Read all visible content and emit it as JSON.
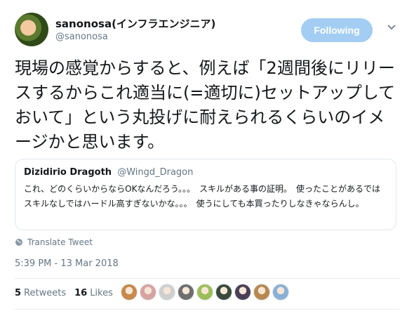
{
  "header": {
    "name": "sanonosa(インフラエンジニア)",
    "handle": "@sanonosa",
    "follow_label": "Following"
  },
  "tweet": {
    "text": "現場の感覚からすると、例えば「2週間後にリリースするからこれ適当に(=適切に)セットアップしておいて」という丸投げに耐えられるくらいのイメージかと思います。"
  },
  "quote": {
    "name": "Dizidirio Dragoth",
    "handle": "@Wingd_Dragon",
    "text": "これ、どのくらいからならOKなんだろう。。。　スキルがある事の証明。　使ったことがあるではスキルなしではハードル高すぎないかな。。。　使うにしても本買ったりしなきゃならんし。"
  },
  "translate_label": "Translate Tweet",
  "timestamp": "5:39 PM - 13 Mar 2018",
  "stats": {
    "retweets_count": "5",
    "retweets_label": "Retweets",
    "likes_count": "16",
    "likes_label": "Likes"
  },
  "likers": [
    {
      "icon": "liker-avatar",
      "color": "#c98a4b"
    },
    {
      "icon": "liker-avatar",
      "color": "#d7a3a0"
    },
    {
      "icon": "liker-avatar",
      "color": "#cfcfcf"
    },
    {
      "icon": "liker-avatar",
      "color": "#6e6e6e"
    },
    {
      "icon": "liker-avatar",
      "color": "#9bbf58"
    },
    {
      "icon": "liker-avatar",
      "color": "#3a4a3a"
    },
    {
      "icon": "liker-avatar",
      "color": "#4b3f57"
    },
    {
      "icon": "liker-avatar",
      "color": "#b9874f"
    },
    {
      "icon": "liker-avatar",
      "color": "#8ab0d6"
    }
  ],
  "colors": {
    "follow_button_bg": "#a3cdf3",
    "secondary_text": "#657786",
    "primary_text": "#14171a"
  }
}
